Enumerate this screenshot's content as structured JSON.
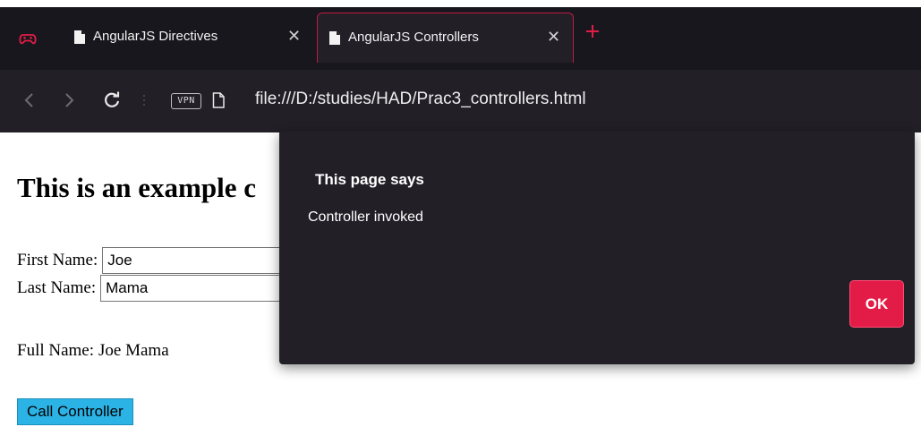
{
  "browser": {
    "tabs": [
      {
        "title": "AngularJS Directives",
        "active": false
      },
      {
        "title": "AngularJS Controllers",
        "active": true
      }
    ],
    "close_glyph": "✕",
    "address": {
      "vpn_label": "VPN",
      "url": "file:///D:/studies/HAD/Prac3_controllers.html"
    },
    "icons": {
      "logo": "gamepad-logo-icon",
      "back": "back-arrow-icon",
      "forward": "forward-arrow-icon",
      "reload": "reload-icon",
      "new_tab": "plus-icon",
      "page": "page-icon"
    },
    "colors": {
      "accent": "#e31c47",
      "chrome_bg": "#221f27",
      "tabbar_bg": "#18171d",
      "button_blue": "#2cb3e6"
    }
  },
  "page": {
    "heading": "This is an example c",
    "first_name_label": "First Name:",
    "first_name_value": "Joe",
    "last_name_label": "Last Name:",
    "last_name_value": "Mama",
    "full_name_label": "Full Name:",
    "full_name_value": "Joe Mama",
    "call_button_label": "Call Controller"
  },
  "dialog": {
    "title": "This page says",
    "message": "Controller invoked",
    "ok_label": "OK"
  }
}
